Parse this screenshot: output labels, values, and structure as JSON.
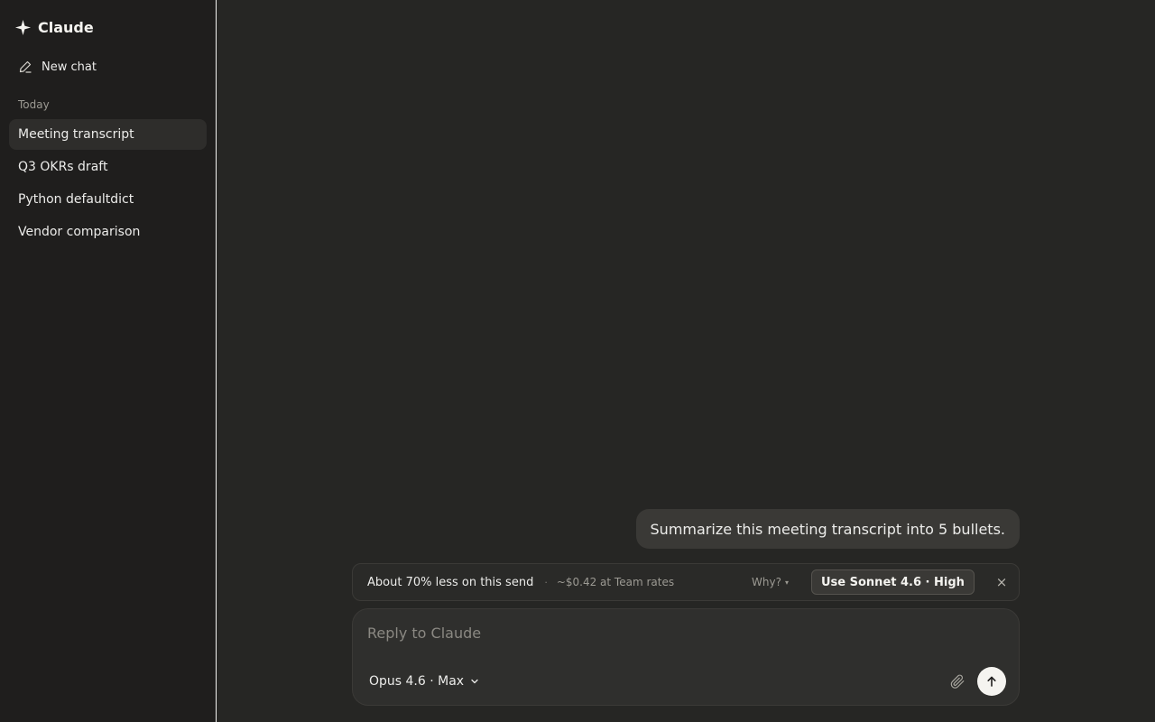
{
  "app": {
    "name": "Claude"
  },
  "sidebar": {
    "new_chat_label": "New chat",
    "section_label": "Today",
    "items": [
      {
        "label": "Meeting transcript",
        "active": true
      },
      {
        "label": "Q3 OKRs draft",
        "active": false
      },
      {
        "label": "Python defaultdict",
        "active": false
      },
      {
        "label": "Vendor comparison",
        "active": false
      }
    ]
  },
  "conversation": {
    "user_message": "Summarize this meeting transcript into 5 bullets."
  },
  "suggestion": {
    "savings": "About 70% less on this send",
    "separator": "·",
    "cost": "~$0.42 at Team rates",
    "why_label": "Why?",
    "why_caret": "▾",
    "action_label": "Use Sonnet 4.6 · High",
    "close_glyph": "×"
  },
  "composer": {
    "placeholder": "Reply to Claude",
    "value": "",
    "model_label": "Opus 4.6 · Max"
  },
  "icons": {
    "brand": "sparkle-icon",
    "new_chat": "pencil-icon",
    "model_menu": "chevron-down-icon",
    "attach": "paperclip-icon",
    "send": "arrow-up-icon",
    "dismiss": "close-icon"
  },
  "colors": {
    "sidebar_bg": "#1f1e1d",
    "main_bg": "#262624",
    "bubble_bg": "#3a3936",
    "send_bg": "#f5f4f0"
  }
}
